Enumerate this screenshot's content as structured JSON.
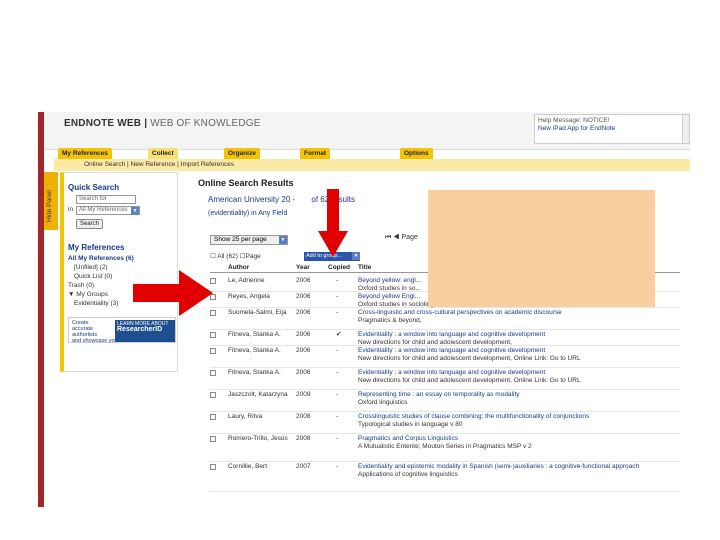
{
  "header": {
    "app_name": "ENDNOTE",
    "app_name2": "WEB",
    "wok": "WEB OF KNOWLEDGE",
    "message_lines": [
      "Help Message: NOTICE!",
      "New iPad App for EndNote"
    ]
  },
  "tabs": [
    "My References",
    "Collect",
    "Organize",
    "Format",
    "Options"
  ],
  "subnav": [
    "Online Search",
    "New Reference",
    "Import References"
  ],
  "side_tab": "Hide Panel",
  "sidebar": {
    "quick_search_title": "Quick Search",
    "search_placeholder": "Search for",
    "in_label": "in",
    "in_value": "All My References",
    "search_button": "Search",
    "my_refs_title": "My References",
    "items": [
      "All My References (6)",
      "[Unfiled] (2)",
      "Quick List (0)",
      "Trash (0)",
      "My Groups",
      "Evidentiality (3)"
    ],
    "researcher": {
      "left": [
        "Create",
        "accurate",
        "authorlists",
        "and showcase your work"
      ],
      "right_top": "LEARN MORE ABOUT",
      "brand": "ResearcherID"
    }
  },
  "results": {
    "title": "Online Search Results",
    "query_line": "American University",
    "query_range": "20 -",
    "query_total": "of 62 results",
    "query_field": "(evidentiality) in Any Field",
    "show_per_page": "Show 25 per page",
    "page_label": "Page",
    "all_label": "All (62)",
    "page_check": "Page",
    "add_to_group": "Add to group...",
    "columns": [
      "Author",
      "Year",
      "Copied",
      "Title"
    ],
    "rows": [
      {
        "author": "Le, Adrienne",
        "year": "2006",
        "copied": "-",
        "title": "Beyond yellow: engl...",
        "sub": "Oxford studies in so..."
      },
      {
        "author": "Reyes, Angela",
        "year": "2006",
        "copied": "-",
        "title": "Beyond yellow Engl...",
        "sub": "Oxford studies in sociolinguistics"
      },
      {
        "author": "Suomela-Salmi, Eija",
        "year": "2006",
        "copied": "-",
        "title": "Cross-linguistic and cross-cultural perspectives on academic discourse",
        "sub": "Pragmatics & beyond,"
      },
      {
        "author": "Fitneva, Stanka A.",
        "year": "2006",
        "copied": "✔",
        "title": "Evidentiality : a window into language and cognitive development",
        "sub": "New directions for child and adolescent development,"
      },
      {
        "author": "Fitneva, Stanka A.",
        "year": "2006",
        "copied": "-",
        "title": "Evidentiality : a window into language and cognitive development",
        "sub": "New directions for child and adolescent development, Online Link: Go to URL"
      },
      {
        "author": "Fitneva, Stanka A.",
        "year": "2006",
        "copied": "-",
        "title": "Evidentiality : a window into language and cognitive development",
        "sub": "New directions for child and adolescent development, Online Link: Go to URL"
      },
      {
        "author": "Jaszczolt, Katarzyna",
        "year": "2009",
        "copied": "-",
        "title": "Representing time : an essay on temporality as modality",
        "sub": "Oxford linguistics"
      },
      {
        "author": "Laury, Ritva",
        "year": "2008",
        "copied": "-",
        "title": "Crosslinguistic studies of clause combining: the multifunctionality of conjunctions",
        "sub": "Typological studies in language v 80"
      },
      {
        "author": "Romero-Trillo, Jesús",
        "year": "2008",
        "copied": "-",
        "title": "Pragmatics and Corpus Linguistics",
        "sub": "A Mutualistic Entente; Mouton Series in Pragmatics MSP v 2"
      },
      {
        "author": "Cornillie, Bert",
        "year": "2007",
        "copied": "-",
        "title": "Evidentiality and epistemic modality in Spanish (semi-)auxiliaries : a cognitive-functional approach",
        "sub": "Applications of cognitive linguistics"
      }
    ]
  },
  "colors": {
    "overlay": "#f9cf9e",
    "arrow": "#e00000",
    "tab": "#f5c400",
    "link": "#1a3a8a"
  }
}
